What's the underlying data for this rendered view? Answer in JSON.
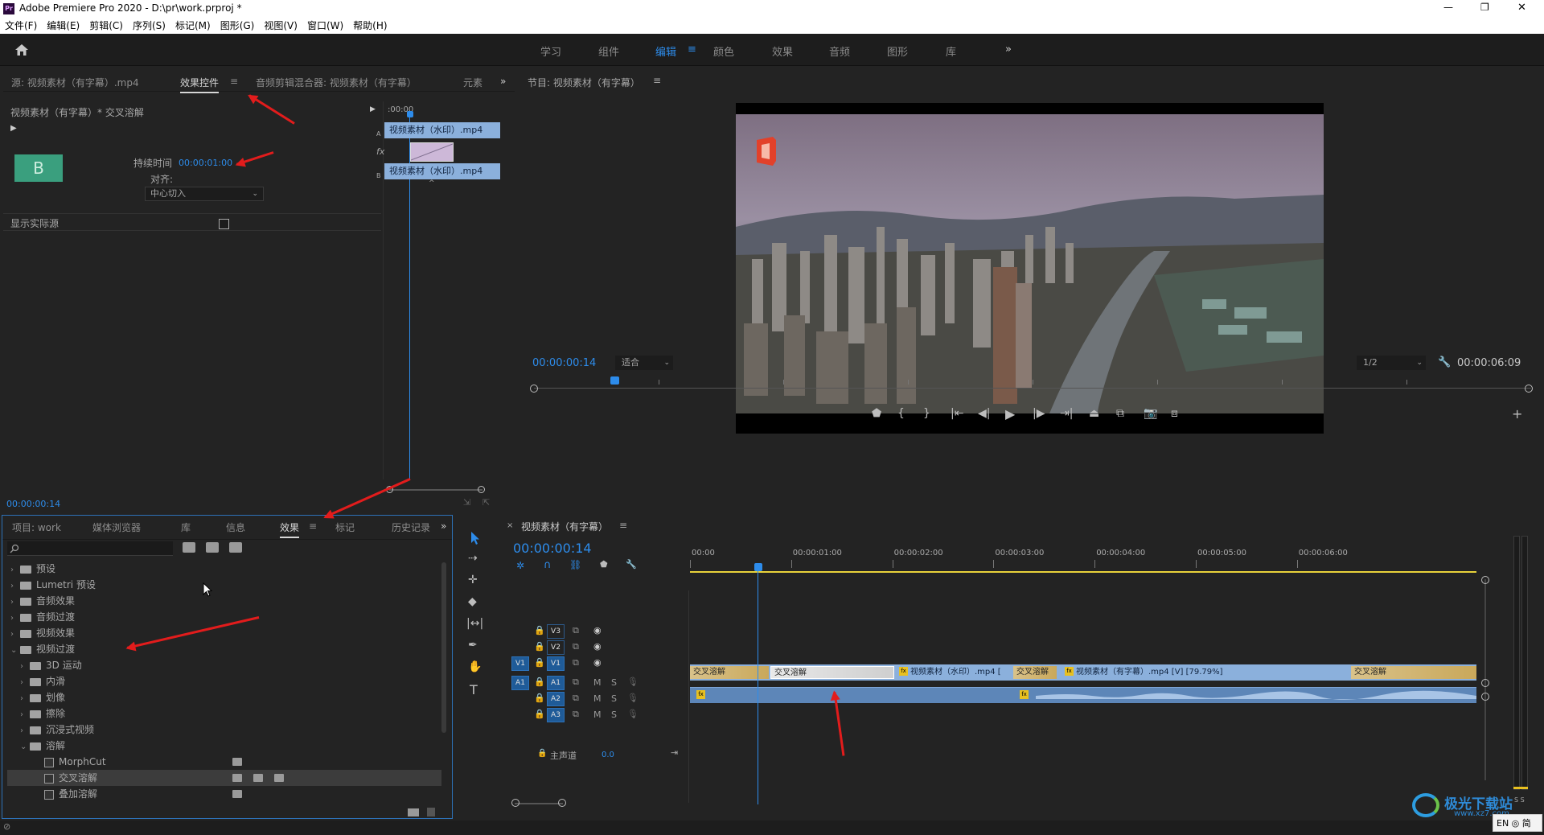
{
  "app": {
    "title": "Adobe Premiere Pro 2020 - D:\\pr\\work.prproj *",
    "logo": "Pr",
    "window_controls": [
      "—",
      "❐",
      "✕"
    ]
  },
  "menu": [
    "文件(F)",
    "编辑(E)",
    "剪辑(C)",
    "序列(S)",
    "标记(M)",
    "图形(G)",
    "视图(V)",
    "窗口(W)",
    "帮助(H)"
  ],
  "workspaces": {
    "items": [
      "学习",
      "组件",
      "编辑",
      "颜色",
      "效果",
      "音频",
      "图形",
      "库"
    ],
    "active": "编辑",
    "more": "»"
  },
  "source_panel": {
    "tabs": [
      "源: 视频素材（有字幕）.mp4",
      "效果控件",
      "音频剪辑混合器: 视频素材（有字幕）",
      "元素"
    ],
    "active_tab": "效果控件",
    "clip_label": "视频素材（有字幕）* 交叉溶解",
    "duration_label": "持续时间",
    "duration_value": "00:00:01:00",
    "align_label": "对齐:",
    "align_value": "中心切入",
    "show_source_label": "显示实际源",
    "b_label": "B",
    "mini_time": ":00:00",
    "clip_a": "视频素材（水印）.mp4",
    "clip_b": "视频素材（水印）.mp4",
    "track_a": "A",
    "track_b": "B",
    "fx": "fx",
    "timecode": "00:00:00:14"
  },
  "program_panel": {
    "title": "节目: 视频素材（有字幕）",
    "timecode": "00:00:00:14",
    "fit": "适合",
    "resolution": "1/2",
    "duration": "00:00:06:09",
    "playhead_fraction": 0.081
  },
  "project_panel": {
    "tabs": [
      "项目: work",
      "媒体浏览器",
      "库",
      "信息",
      "效果",
      "标记",
      "历史记录"
    ],
    "active_tab": "效果",
    "tree": [
      {
        "label": "预设",
        "level": 0,
        "expanded": false,
        "type": "folder"
      },
      {
        "label": "Lumetri 预设",
        "level": 0,
        "expanded": false,
        "type": "folder"
      },
      {
        "label": "音频效果",
        "level": 0,
        "expanded": false,
        "type": "folder"
      },
      {
        "label": "音频过渡",
        "level": 0,
        "expanded": false,
        "type": "folder"
      },
      {
        "label": "视频效果",
        "level": 0,
        "expanded": false,
        "type": "folder"
      },
      {
        "label": "视频过渡",
        "level": 0,
        "expanded": true,
        "type": "folder"
      },
      {
        "label": "3D 运动",
        "level": 1,
        "expanded": false,
        "type": "folder"
      },
      {
        "label": "内滑",
        "level": 1,
        "expanded": false,
        "type": "folder"
      },
      {
        "label": "划像",
        "level": 1,
        "expanded": false,
        "type": "folder"
      },
      {
        "label": "擦除",
        "level": 1,
        "expanded": false,
        "type": "folder"
      },
      {
        "label": "沉浸式视频",
        "level": 1,
        "expanded": false,
        "type": "folder"
      },
      {
        "label": "溶解",
        "level": 1,
        "expanded": true,
        "type": "folder"
      },
      {
        "label": "MorphCut",
        "level": 2,
        "type": "effect"
      },
      {
        "label": "交叉溶解",
        "level": 2,
        "type": "effect",
        "selected": true
      },
      {
        "label": "叠加溶解",
        "level": 2,
        "type": "effect"
      }
    ]
  },
  "timeline": {
    "title": "视频素材（有字幕）",
    "timecode": "00:00:00:14",
    "ruler": [
      "00:00",
      "00:00:01:00",
      "00:00:02:00",
      "00:00:03:00",
      "00:00:04:00",
      "00:00:05:00",
      "00:00:06:00"
    ],
    "tracks": [
      {
        "name": "V3",
        "target": "",
        "extra": "eye"
      },
      {
        "name": "V2",
        "target": "",
        "extra": "eye"
      },
      {
        "name": "V1",
        "target": "V1",
        "extra": "eye"
      },
      {
        "name": "A1",
        "target": "A1",
        "extra": "mic"
      },
      {
        "name": "A2",
        "target": "",
        "extra": "mic"
      },
      {
        "name": "A3",
        "target": "",
        "extra": "mic"
      }
    ],
    "master_label": "主声道",
    "master_value": "0.0",
    "m": "M",
    "s": "S",
    "transition_label": "交叉溶解",
    "clip1": "视频素材（水印）.mp4 [",
    "clip2": "视频素材（有字幕）.mp4 [V] [79.79%]",
    "fx": "fx"
  },
  "watermark": {
    "brand": "极光下载站",
    "url": "www.xz7.com"
  },
  "ime": "EN ◎ 简",
  "meter_labels": "S S",
  "colors": {
    "accent": "#2d8ceb",
    "clip": "#8bb0dc",
    "transition": "#d9c28a"
  }
}
